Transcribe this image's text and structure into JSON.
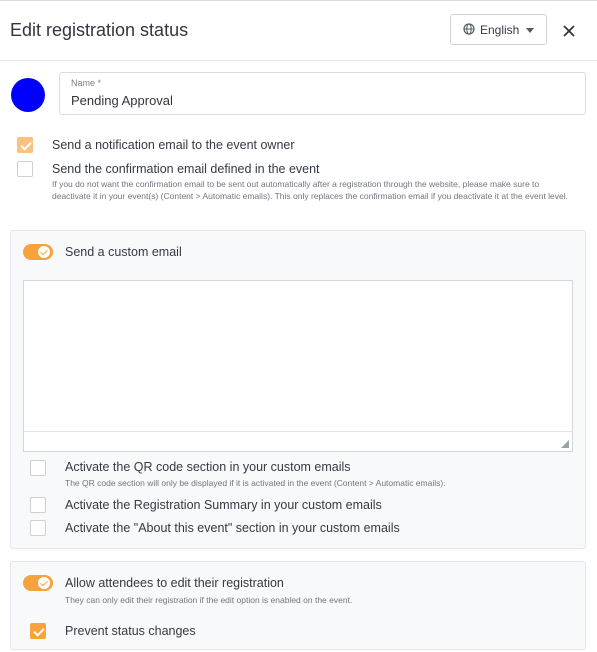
{
  "header": {
    "title": "Edit registration status",
    "language": {
      "label": "English",
      "icon": "globe-icon"
    },
    "close_icon": "close-icon"
  },
  "status": {
    "color": "#0000ff",
    "name_label": "Name *",
    "name_value": "Pending Approval"
  },
  "notifications": {
    "owner_email": {
      "label": "Send a notification email to the event owner",
      "checked": true
    },
    "confirmation_email": {
      "label": "Send the confirmation email defined in the event",
      "help": "If you do not want the confirmation email to be sent out automatically after a registration through the website, please make sure to deactivate it in your event(s) (Content > Automatic emails). This only replaces the confirmation email if you deactivate it at the event level.",
      "checked": false
    }
  },
  "custom_email": {
    "toggle_label": "Send a custom email",
    "enabled": true,
    "editor_value": "",
    "options": [
      {
        "label": "Activate the QR code section in your custom emails",
        "help": "The QR code section will only be displayed if it is activated in the event (Content > Automatic emails).",
        "checked": false
      },
      {
        "label": "Activate the Registration Summary in your custom emails",
        "checked": false
      },
      {
        "label": "Activate the \"About this event\" section in your custom emails",
        "checked": false
      }
    ]
  },
  "edit_registration": {
    "toggle_label": "Allow attendees to edit their registration",
    "help": "They can only edit their registration if the edit option is enabled on the event.",
    "enabled": true,
    "prevent_status": {
      "label": "Prevent status changes",
      "checked": true
    }
  },
  "colors": {
    "accent": "#f6a23d",
    "status_dot": "#0000ff"
  }
}
